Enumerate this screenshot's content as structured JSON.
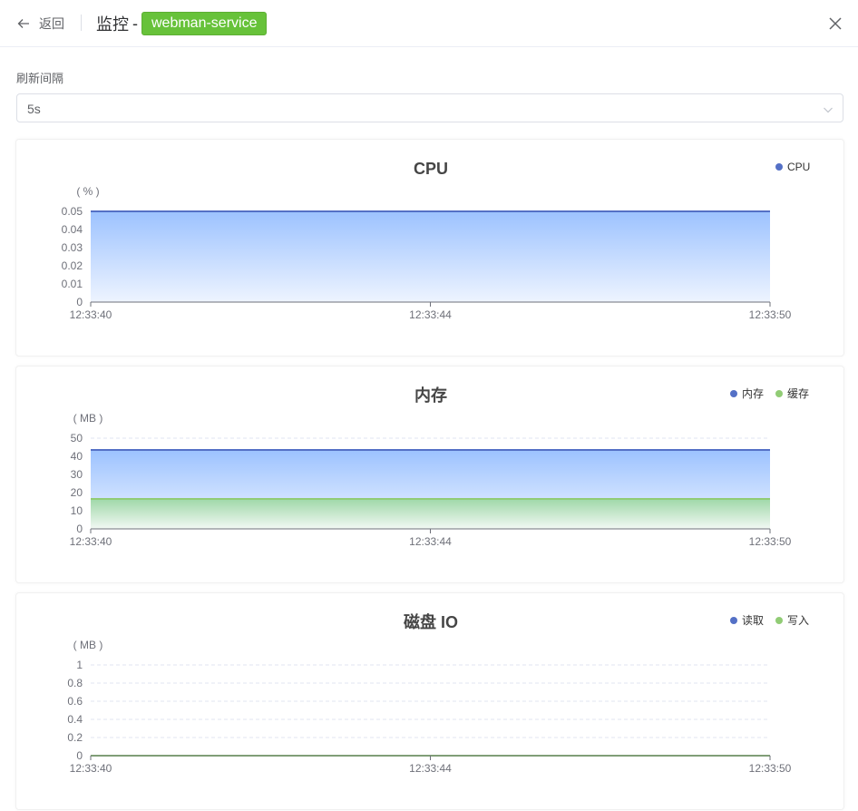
{
  "header": {
    "back_label": "返回",
    "title_prefix": "监控",
    "title_separator": "-",
    "service_name": "webman-service"
  },
  "refresh": {
    "label": "刷新间隔",
    "value": "5s"
  },
  "colors": {
    "blue": "#5470c6",
    "green": "#91cc75",
    "tag_green": "#67c23a"
  },
  "charts": [
    {
      "title": "CPU",
      "unit": "( % )",
      "y_ticks": [
        "0",
        "0.01",
        "0.02",
        "0.03",
        "0.04",
        "0.05"
      ],
      "x_ticks": [
        "12:33:40",
        "12:33:44",
        "12:33:50"
      ],
      "legend": [
        "CPU"
      ]
    },
    {
      "title": "内存",
      "unit": "( MB )",
      "y_ticks": [
        "0",
        "10",
        "20",
        "30",
        "40",
        "50"
      ],
      "x_ticks": [
        "12:33:40",
        "12:33:44",
        "12:33:50"
      ],
      "legend": [
        "内存",
        "缓存"
      ]
    },
    {
      "title": "磁盘 IO",
      "unit": "( MB )",
      "y_ticks": [
        "0",
        "0.2",
        "0.4",
        "0.6",
        "0.8",
        "1"
      ],
      "x_ticks": [
        "12:33:40",
        "12:33:44",
        "12:33:50"
      ],
      "legend": [
        "读取",
        "写入"
      ]
    }
  ],
  "chart_data": [
    {
      "type": "area",
      "title": "CPU",
      "ylabel": "( % )",
      "ylim": [
        0,
        0.05
      ],
      "x": [
        "12:33:40",
        "12:33:44",
        "12:33:50"
      ],
      "series": [
        {
          "name": "CPU",
          "values": [
            0.05,
            0.05,
            0.05
          ],
          "color": "#5470c6"
        }
      ],
      "legend": "top-right",
      "grid": true
    },
    {
      "type": "area",
      "title": "内存",
      "ylabel": "( MB )",
      "ylim": [
        0,
        50
      ],
      "x": [
        "12:33:40",
        "12:33:44",
        "12:33:50"
      ],
      "series": [
        {
          "name": "内存",
          "values": [
            43.5,
            43.5,
            43.5
          ],
          "color": "#5470c6"
        },
        {
          "name": "缓存",
          "values": [
            16.5,
            16.5,
            16.5
          ],
          "color": "#91cc75"
        }
      ],
      "legend": "top-right",
      "grid": true
    },
    {
      "type": "line",
      "title": "磁盘 IO",
      "ylabel": "( MB )",
      "ylim": [
        0,
        1
      ],
      "x": [
        "12:33:40",
        "12:33:44",
        "12:33:50"
      ],
      "series": [
        {
          "name": "读取",
          "values": [
            0,
            0,
            0
          ],
          "color": "#5470c6"
        },
        {
          "name": "写入",
          "values": [
            0,
            0,
            0
          ],
          "color": "#91cc75"
        }
      ],
      "legend": "top-right",
      "grid": true
    }
  ]
}
